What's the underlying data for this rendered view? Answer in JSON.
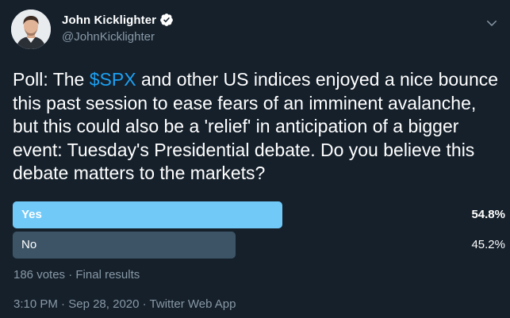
{
  "author": {
    "display_name": "John Kicklighter",
    "handle": "@JohnKicklighter",
    "verified": true
  },
  "tweet": {
    "text_before": "Poll: The ",
    "cashtag": "$SPX",
    "text_after": " and other US indices enjoyed a nice bounce this past session to ease fears of an imminent avalanche, but this could also be a 'relief' in anticipation of a bigger event: Tuesday's Presidential debate. Do you believe this debate matters to the markets?"
  },
  "poll": {
    "options": [
      {
        "label": "Yes",
        "percent_text": "54.8%",
        "percent": 54.8,
        "winner": true
      },
      {
        "label": "No",
        "percent_text": "45.2%",
        "percent": 45.2,
        "winner": false
      }
    ],
    "votes": "186 votes",
    "separator": " · ",
    "status": "Final results"
  },
  "footer": {
    "time": "3:10 PM",
    "date": "Sep 28, 2020",
    "source": "Twitter Web App",
    "separator": " · "
  },
  "colors": {
    "background": "#15202b",
    "accent": "#1da1f2",
    "winner_bar": "#71c9f8",
    "loser_bar": "#3d5466",
    "secondary_text": "#8899a6"
  },
  "icons": {
    "verified": "verified-badge-icon",
    "caret": "chevron-down-icon"
  }
}
